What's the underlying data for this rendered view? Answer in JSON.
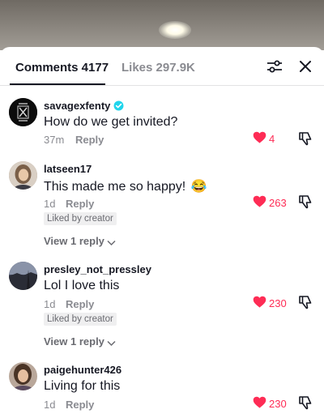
{
  "tabs": {
    "comments_label": "Comments 4177",
    "likes_label": "Likes 297.9K"
  },
  "colors": {
    "like": "#fe2c55",
    "verified": "#20d5ec"
  },
  "comments": [
    {
      "username": "savagexfenty",
      "verified": true,
      "text": "How do we get invited?",
      "time": "37m",
      "reply_label": "Reply",
      "likes": "4"
    },
    {
      "username": "latseen17",
      "text": "This made me so happy!",
      "emoji": "😂",
      "time": "1d",
      "reply_label": "Reply",
      "likes": "263",
      "badge": "Liked by creator",
      "view_replies": "View 1 reply"
    },
    {
      "username": "presley_not_pressley",
      "text": "Lol I love this",
      "time": "1d",
      "reply_label": "Reply",
      "likes": "230",
      "badge": "Liked by creator",
      "view_replies": "View 1 reply"
    },
    {
      "username": "paigehunter426",
      "text": "Living for this",
      "time": "1d",
      "reply_label": "Reply",
      "likes": "230"
    }
  ]
}
